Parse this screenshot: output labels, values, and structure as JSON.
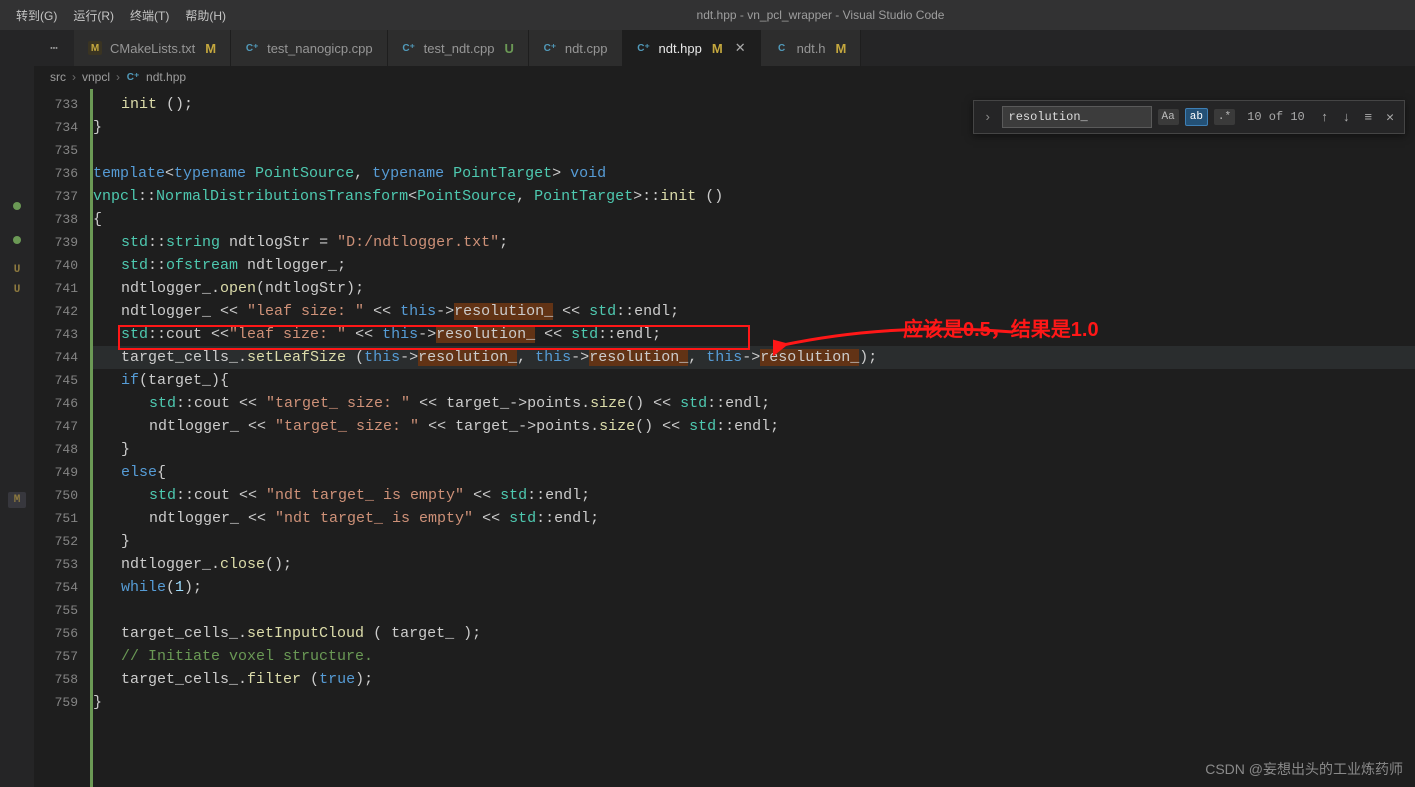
{
  "menubar": {
    "goto": "转到(G)",
    "run": "运行(R)",
    "terminal": "终端(T)",
    "help": "帮助(H)",
    "title": "ndt.hpp - vn_pcl_wrapper - Visual Studio Code"
  },
  "tabs": [
    {
      "icon": "M",
      "label": "CMakeLists.txt",
      "badge": "M",
      "active": false
    },
    {
      "icon": "C⁺",
      "label": "test_nanogicp.cpp",
      "badge": "",
      "active": false
    },
    {
      "icon": "C⁺",
      "label": "test_ndt.cpp",
      "badge": "U",
      "active": false
    },
    {
      "icon": "C⁺",
      "label": "ndt.cpp",
      "badge": "",
      "active": false
    },
    {
      "icon": "C⁺",
      "label": "ndt.hpp",
      "badge": "M",
      "active": true,
      "close": true
    },
    {
      "icon": "C",
      "label": "ndt.h",
      "badge": "M",
      "active": false
    }
  ],
  "breadcrumb": {
    "p0": "src",
    "p1": "vnpcl",
    "p2": "ndt.hpp"
  },
  "find": {
    "value": "resolution_",
    "count": "10 of 10",
    "case": "Aa",
    "word": "ab",
    "regex": ".*"
  },
  "explorer": {
    "u": "U",
    "m": "M"
  },
  "line_numbers": [
    "733",
    "734",
    "735",
    "736",
    "737",
    "738",
    "739",
    "740",
    "741",
    "742",
    "743",
    "744",
    "745",
    "746",
    "747",
    "748",
    "749",
    "750",
    "751",
    "752",
    "753",
    "754",
    "755",
    "756",
    "757",
    "758",
    "759"
  ],
  "code": {
    "l733_a": "init",
    "l733_b": " ();",
    "l734": "}",
    "l736_a": "template",
    "l736_b": "<",
    "l736_c": "typename",
    "l736_d": " PointSource",
    "l736_e": ", ",
    "l736_f": "typename",
    "l736_g": " PointTarget",
    "l736_h": "> ",
    "l736_i": "void",
    "l737_a": "vnpcl",
    "l737_b": "::",
    "l737_c": "NormalDistributionsTransform",
    "l737_d": "<",
    "l737_e": "PointSource",
    "l737_f": ", ",
    "l737_g": "PointTarget",
    "l737_h": ">::",
    "l737_i": "init",
    "l737_j": " ()",
    "l738": "{",
    "l739_a": "std",
    "l739_b": "::",
    "l739_c": "string",
    "l739_d": " ndtlogStr = ",
    "l739_e": "\"D:/ndtlogger.txt\"",
    "l739_f": ";",
    "l740_a": "std",
    "l740_b": "::",
    "l740_c": "ofstream",
    "l740_d": " ndtlogger_;",
    "l741_a": "ndtlogger_.",
    "l741_b": "open",
    "l741_c": "(ndtlogStr);",
    "l742_a": "ndtlogger_ << ",
    "l742_b": "\"leaf size: \"",
    "l742_c": " << ",
    "l742_d": "this",
    "l742_e": "->",
    "l742_f": "resolution_",
    "l742_g": " << ",
    "l742_h": "std",
    "l742_i": "::endl;",
    "l743_a": "std",
    "l743_b": "::cout <<",
    "l743_c": "\"leaf size: \"",
    "l743_d": " << ",
    "l743_e": "this",
    "l743_f": "->",
    "l743_g": "resolution_",
    "l743_h": " << ",
    "l743_i": "std",
    "l743_j": "::endl;",
    "l744_a": "target_cells_.",
    "l744_b": "setLeafSize",
    "l744_c": " (",
    "l744_d": "this",
    "l744_e": "->",
    "l744_f": "resolution_",
    "l744_g": ", ",
    "l744_h": "this",
    "l744_i": "->",
    "l744_j": "resolution_",
    "l744_k": ", ",
    "l744_l": "this",
    "l744_m": "->",
    "l744_n": "resolution_",
    "l744_o": ");",
    "l745_a": "if",
    "l745_b": "(target_){",
    "l746_a": "std",
    "l746_b": "::cout << ",
    "l746_c": "\"target_ size: \"",
    "l746_d": " << target_->points.",
    "l746_e": "size",
    "l746_f": "() << ",
    "l746_g": "std",
    "l746_h": "::endl;",
    "l747_a": "ndtlogger_ << ",
    "l747_b": "\"target_ size: \"",
    "l747_c": " << target_->points.",
    "l747_d": "size",
    "l747_e": "() << ",
    "l747_f": "std",
    "l747_g": "::endl;",
    "l748": "}",
    "l749_a": "else",
    "l749_b": "{",
    "l750_a": "std",
    "l750_b": "::cout << ",
    "l750_c": "\"ndt target_ is empty\"",
    "l750_d": " << ",
    "l750_e": "std",
    "l750_f": "::endl;",
    "l751_a": "ndtlogger_ << ",
    "l751_b": "\"ndt target_ is empty\"",
    "l751_c": " << ",
    "l751_d": "std",
    "l751_e": "::endl;",
    "l752": "}",
    "l753_a": "ndtlogger_.",
    "l753_b": "close",
    "l753_c": "();",
    "l754_a": "while",
    "l754_b": "(",
    "l754_c": "1",
    "l754_d": ");",
    "l756_a": "target_cells_.",
    "l756_b": "setInputCloud",
    "l756_c": " ( target_ );",
    "l757": "// Initiate voxel structure.",
    "l758_a": "target_cells_.",
    "l758_b": "filter",
    "l758_c": " (",
    "l758_d": "true",
    "l758_e": ");",
    "l759": "}"
  },
  "annotation": "应该是0.5，结果是1.0",
  "watermark": "CSDN @妄想出头的工业炼药师"
}
